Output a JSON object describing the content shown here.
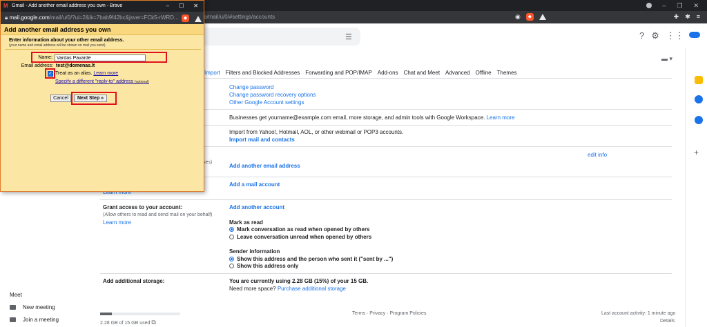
{
  "browser": {
    "address": "a/mail/u/0/#settings/accounts"
  },
  "gmail": {
    "tabs": [
      {
        "label": "Import",
        "active": true
      },
      {
        "label": "Filters and Blocked Addresses",
        "active": false
      },
      {
        "label": "Forwarding and POP/IMAP",
        "active": false
      },
      {
        "label": "Add-ons",
        "active": false
      },
      {
        "label": "Chat and Meet",
        "active": false
      },
      {
        "label": "Advanced",
        "active": false
      },
      {
        "label": "Offline",
        "active": false
      },
      {
        "label": "Themes",
        "active": false
      }
    ],
    "change_account": {
      "links": [
        "Change password",
        "Change password recovery options",
        "Other Google Account settings"
      ]
    },
    "workspace": {
      "text": "Businesses get yourname@example.com email, more storage, and admin tools with Google Workspace.",
      "link": "Learn more"
    },
    "import": {
      "text": "Import from Yahoo!, Hotmail, AOL, or other webmail or POP3 accounts.",
      "link": "Import mail and contacts"
    },
    "send_mail_as": {
      "left_frag": "ses)",
      "edit_info": "edit info",
      "link": "Add another email address"
    },
    "check_mail": {
      "left_frag": "Learn more",
      "link": "Add a mail account"
    },
    "grant_access": {
      "title": "Grant access to your account:",
      "sub": "(Allow others to read and send mail on your behalf)",
      "learn_more": "Learn more",
      "link": "Add another account",
      "mark_as_read": "Mark as read",
      "options": [
        "Mark conversation as read when opened by others",
        "Leave conversation unread when opened by others"
      ],
      "sender_info": "Sender information",
      "sender_options": [
        "Show this address and the person who sent it (\"sent by ...\")",
        "Show this address only"
      ]
    },
    "storage": {
      "label": "Add additional storage:",
      "usage": "You are currently using 2.28 GB (15%) of your 15 GB.",
      "need_more": "Need more space?",
      "purchase": "Purchase additional storage",
      "footer_used": "2.28 GB of 15 GB used",
      "fraction": 0.15
    },
    "footer": {
      "links": "Terms · Privacy · Program Policies",
      "activity": "Last account activity: 1 minute ago",
      "details": "Details"
    },
    "meet": {
      "title": "Meet",
      "new_meeting": "New meeting",
      "join": "Join a meeting"
    }
  },
  "popup": {
    "title": "Gmail - Add another email address you own - Brave",
    "url_host": "mail.google.com",
    "url_path": "/mail/u/0/?ui=2&ik=7bab9f42bc&jsver=FCk5-rWRD...",
    "heading": "Add another email address you own",
    "instructions": "Enter information about your other email address.",
    "sub_instructions": "(your name and email address will be shown on mail you send)",
    "name_label": "Name:",
    "name_value": "Vardas Pavardė",
    "email_label": "Email address:",
    "email_value": "test@domenas.lt",
    "alias_label": "Treat as an alias.",
    "alias_link": "Learn more",
    "reply_to_link": "Specify a different \"reply-to\" address",
    "reply_to_optional": "(optional)",
    "cancel": "Cancel",
    "next": "Next Step »"
  }
}
